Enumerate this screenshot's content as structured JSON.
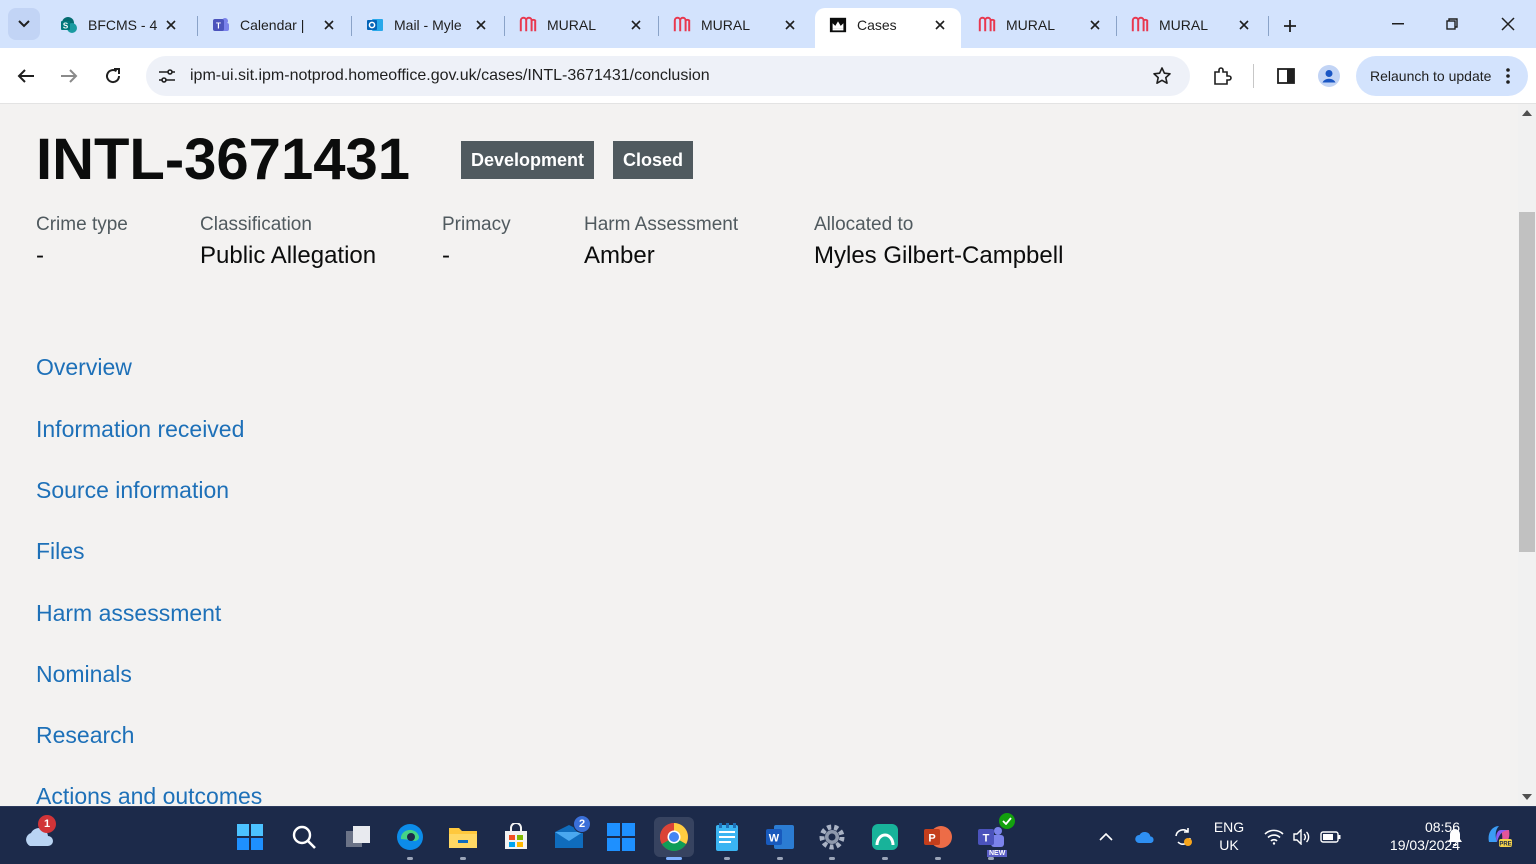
{
  "browser": {
    "tabs": [
      {
        "title": "BFCMS - 4",
        "icon": "sharepoint-icon",
        "active": false
      },
      {
        "title": "Calendar |",
        "icon": "teams-icon",
        "active": false
      },
      {
        "title": "Mail - Myle",
        "icon": "outlook-icon",
        "active": false
      },
      {
        "title": "MURAL",
        "icon": "mural-icon",
        "active": false
      },
      {
        "title": "MURAL",
        "icon": "mural-icon",
        "active": false
      },
      {
        "title": "Cases",
        "icon": "crown-icon",
        "active": true
      },
      {
        "title": "MURAL",
        "icon": "mural-icon",
        "active": false
      },
      {
        "title": "MURAL",
        "icon": "mural-icon",
        "active": false
      }
    ],
    "url": "ipm-ui.sit.ipm-notprod.homeoffice.gov.uk/cases/INTL-3671431/conclusion",
    "relaunch_label": "Relaunch to update"
  },
  "page": {
    "case_id": "INTL-3671431",
    "tags": [
      "Development",
      "Closed"
    ],
    "summary": [
      {
        "label": "Crime type",
        "value": "-"
      },
      {
        "label": "Classification",
        "value": "Public Allegation"
      },
      {
        "label": "Primacy",
        "value": "-"
      },
      {
        "label": "Harm Assessment",
        "value": "Amber"
      },
      {
        "label": "Allocated to",
        "value": "Myles Gilbert-Campbell"
      }
    ],
    "nav_links": [
      "Overview",
      "Information received",
      "Source information",
      "Files",
      "Harm assessment",
      "Nominals",
      "Research",
      "Actions and outcomes"
    ]
  },
  "taskbar": {
    "weather_badge": "1",
    "mail_badge": "2",
    "teams_badge": "NEW",
    "language_line1": "ENG",
    "language_line2": "UK",
    "time": "08:56",
    "date": "19/03/2024",
    "colors": {
      "accent": "#7fb0ff",
      "background": "#1c2a4a"
    }
  }
}
